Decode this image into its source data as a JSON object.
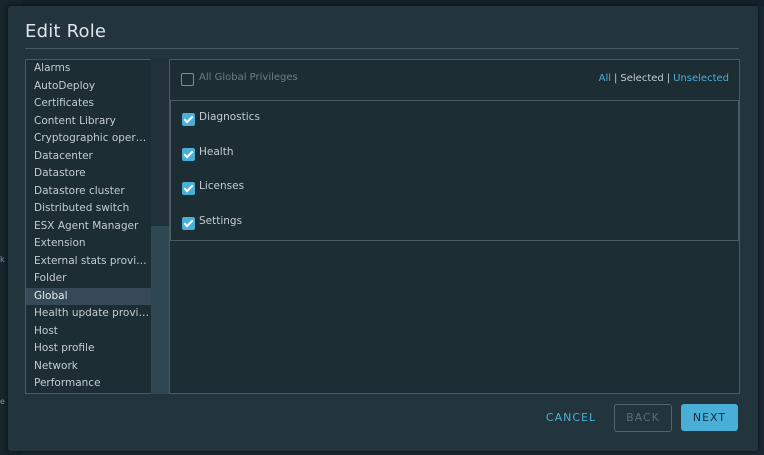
{
  "background": {
    "fragments": [
      "k",
      "e"
    ]
  },
  "dialog": {
    "title": "Edit Role"
  },
  "categories": {
    "items": [
      "Alarms",
      "AutoDeploy",
      "Certificates",
      "Content Library",
      "Cryptographic operati...",
      "Datacenter",
      "Datastore",
      "Datastore cluster",
      "Distributed switch",
      "ESX Agent Manager",
      "Extension",
      "External stats provider",
      "Folder",
      "Global",
      "Health update provider",
      "Host",
      "Host profile",
      "Network",
      "Performance"
    ],
    "selected": "Global"
  },
  "privileges": {
    "all_label": "All Global Privileges",
    "filter": {
      "all": "All",
      "selected": "Selected",
      "unselected": "Unselected",
      "separator": "|"
    },
    "items": [
      {
        "label": "Diagnostics",
        "checked": true
      },
      {
        "label": "Health",
        "checked": true
      },
      {
        "label": "Licenses",
        "checked": true
      },
      {
        "label": "Settings",
        "checked": true
      }
    ]
  },
  "buttons": {
    "cancel": "CANCEL",
    "back": "BACK",
    "next": "NEXT"
  },
  "colors": {
    "accent": "#49afd9",
    "modal_bg": "#22343c",
    "panel_bg": "#1d2d34",
    "selected_row": "#354a56"
  }
}
